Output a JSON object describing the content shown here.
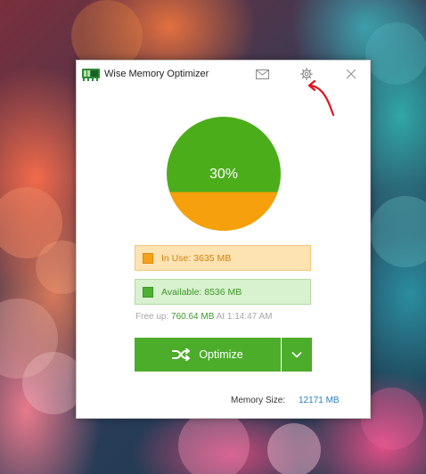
{
  "window": {
    "title": "Wise Memory Optimizer",
    "icons": {
      "app": "app-logo-icon",
      "mail": "mail-icon",
      "settings": "gear-icon",
      "close": "close-icon"
    }
  },
  "pie": {
    "percent_label": "30%",
    "used_fraction": 0.3,
    "used_color": "#f5a00c",
    "available_color": "#4cad1b"
  },
  "stats": {
    "in_use": "In Use: 3635 MB",
    "available": "Available: 8536 MB",
    "free_up_label": "Free up:",
    "free_up_value": "760.64 MB",
    "at_label": "At",
    "time": "1:14:47 AM"
  },
  "optimize": {
    "label": "Optimize",
    "icon": "shuffle-icon",
    "dropdown_icon": "chevron-down-icon"
  },
  "footer": {
    "memory_size_label": "Memory Size:",
    "memory_size_value": "12171 MB"
  },
  "annotation": {
    "icon": "red-arrow-icon",
    "color": "#e0141e"
  }
}
